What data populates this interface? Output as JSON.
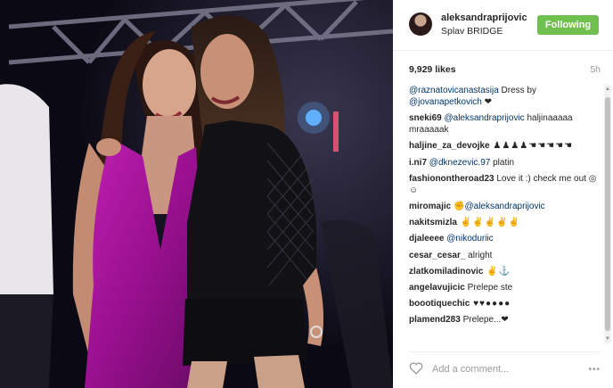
{
  "post": {
    "image_alt": "",
    "colors": {
      "follow": "#70c050",
      "mention": "#003569",
      "dress": "#a8189a"
    }
  },
  "header": {
    "username": "aleksandraprijovic",
    "location": "Splav BRIDGE",
    "follow_label": "Following"
  },
  "stats": {
    "likes": "9,929 likes",
    "time": "5h"
  },
  "comments": [
    {
      "user": "@raznatovicanastasija",
      "user_is_mention": true,
      "text": " Dress by ",
      "mention": "@jovanapetkovich",
      "tail": " ❤"
    },
    {
      "user": "sneki69",
      "mention": "@aleksandraprijovic",
      "text": " haljinaaaaa mraaaaak"
    },
    {
      "user": "haljine_za_devojke",
      "text": " ♟♟♟♟☚☚☚☚☚"
    },
    {
      "user": "i.ni7",
      "mention": "@dknezevic.97",
      "text": " platin"
    },
    {
      "user": "fashionontheroad23",
      "text": " Love it :) check me out ◎☺"
    },
    {
      "user": "miromajic",
      "mention": "@aleksandraprijovic",
      "pre": " ✊"
    },
    {
      "user": "nakitsmizla",
      "text": " ✌✌✌✌✌"
    },
    {
      "user": "djaleeee",
      "mention": "@nikoduriic"
    },
    {
      "user": "cesar_cesar_",
      "text": " alright"
    },
    {
      "user": "zlatkomiladinovic",
      "text": " ✌⚓"
    },
    {
      "user": "angelavujicic",
      "text": " Prelepe ste"
    },
    {
      "user": "boootiquechic",
      "text": " ♥♥●●●●"
    },
    {
      "user": "plamend283",
      "text": " Prelepe...❤"
    }
  ],
  "footer": {
    "placeholder": "Add a comment...",
    "more": "•••"
  }
}
